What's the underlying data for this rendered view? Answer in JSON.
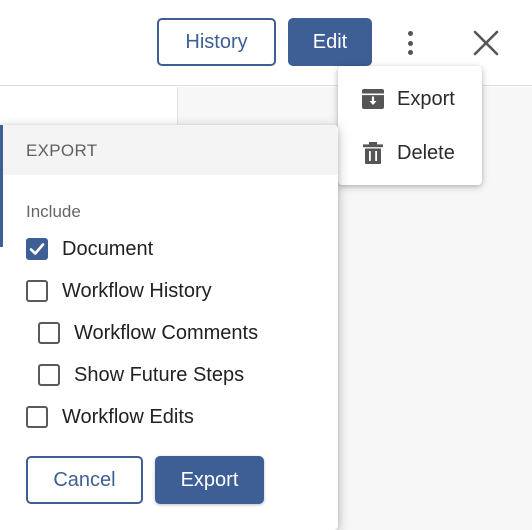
{
  "header": {
    "history_label": "History",
    "edit_label": "Edit",
    "more_icon": "more-vertical-icon",
    "close_icon": "close-icon"
  },
  "menu": {
    "items": [
      {
        "label": "Export",
        "icon": "export-icon"
      },
      {
        "label": "Delete",
        "icon": "trash-icon"
      }
    ]
  },
  "dialog": {
    "title": "EXPORT",
    "include_label": "Include",
    "options": [
      {
        "label": "Document",
        "checked": true
      },
      {
        "label": "Workflow History",
        "checked": false
      },
      {
        "label": "Workflow Comments",
        "checked": false
      },
      {
        "label": "Show Future Steps",
        "checked": false
      },
      {
        "label": "Workflow Edits",
        "checked": false
      }
    ],
    "cancel_label": "Cancel",
    "export_label": "Export"
  },
  "colors": {
    "accent": "#3e5f95",
    "text": "#212121",
    "muted": "#666666"
  }
}
